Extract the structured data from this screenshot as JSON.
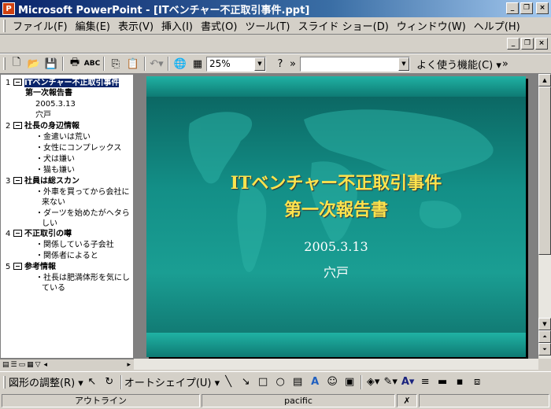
{
  "window": {
    "title": "Microsoft PowerPoint - [ITベンチャー不正取引事件.ppt]",
    "app_icon": "P"
  },
  "menu": [
    "ファイル(F)",
    "編集(E)",
    "表示(V)",
    "挿入(I)",
    "書式(O)",
    "ツール(T)",
    "スライド ショー(D)",
    "ウィンドウ(W)",
    "ヘルプ(H)"
  ],
  "toolbar": {
    "zoom": "25%",
    "font_combo": "",
    "frequent_label": "よく使う機能(C) ▾"
  },
  "outline": {
    "slides": [
      {
        "num": "1",
        "title": "ITベンチャー不正取引事件",
        "title2": "第一次報告書",
        "lines": [
          "2005.3.13",
          "穴戸"
        ]
      },
      {
        "num": "2",
        "title": "社長の身辺情報",
        "bullets": [
          "金遣いは荒い",
          "女性にコンプレックス",
          "犬は嫌い",
          "猫も嫌い"
        ]
      },
      {
        "num": "3",
        "title": "社員は総スカン",
        "bullets": [
          "外車を買ってから会社に",
          "来ない",
          "ダーツを始めたがヘタら",
          "しい"
        ]
      },
      {
        "num": "4",
        "title": "不正取引の噂",
        "bullets": [
          "関係している子会社",
          "関係者によると"
        ]
      },
      {
        "num": "5",
        "title": "参考情報",
        "bullets": [
          "社長は肥満体形を気にし",
          "ている"
        ]
      }
    ]
  },
  "slide": {
    "title_line1": "ITベンチャー不正取引事件",
    "title_line2": "第一次報告書",
    "date": "2005.3.13",
    "author": "穴戸"
  },
  "drawing": {
    "adjust": "図形の調整(R) ▾",
    "autoshape": "オートシェイプ(U) ▾"
  },
  "status": {
    "view": "アウトライン",
    "template": "pacific"
  },
  "colors": {
    "title_bar": "#0a246a",
    "slide_bg": "#138f87",
    "slide_title": "#ffe34d"
  }
}
